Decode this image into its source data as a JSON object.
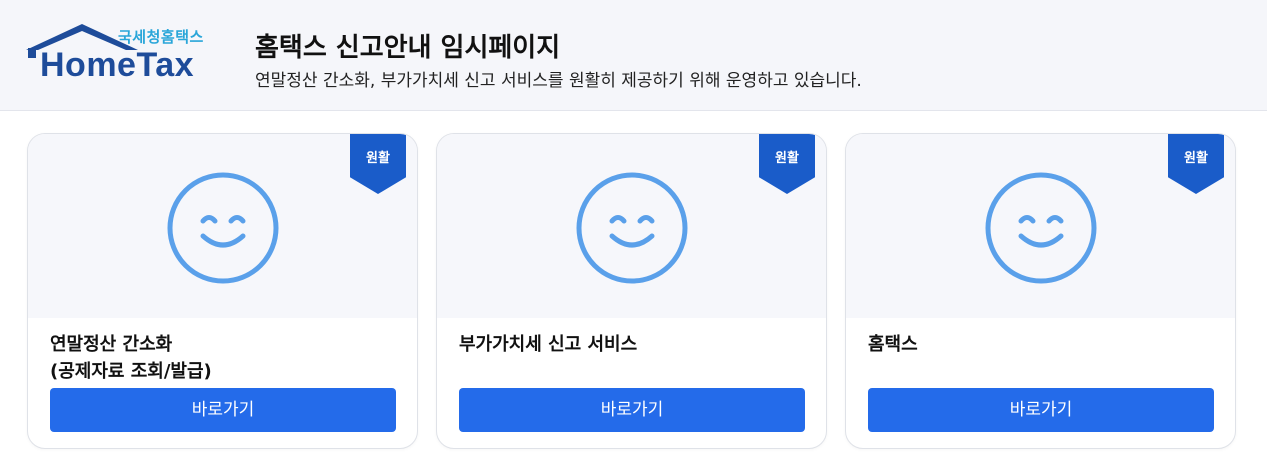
{
  "header": {
    "logo_sub": "국세청홈택스",
    "logo_main": "HomeTax",
    "title": "홈택스 신고안내 임시페이지",
    "description": "연말정산 간소화, 부가가치세 신고 서비스를 원활히 제공하기 위해 운영하고 있습니다."
  },
  "colors": {
    "brand_blue": "#1e4c9a",
    "logo_accent": "#2aa6d9",
    "ribbon": "#1a5cc9",
    "button": "#246bea",
    "smiley": "#5aa0ea"
  },
  "cards": [
    {
      "badge": "원활",
      "icon": "smiley-icon",
      "title": "연말정산 간소화\n(공제자료 조회/발급)",
      "button_label": "바로가기"
    },
    {
      "badge": "원활",
      "icon": "smiley-icon",
      "title": "부가가치세 신고 서비스",
      "button_label": "바로가기"
    },
    {
      "badge": "원활",
      "icon": "smiley-icon",
      "title": "홈택스",
      "button_label": "바로가기"
    }
  ]
}
